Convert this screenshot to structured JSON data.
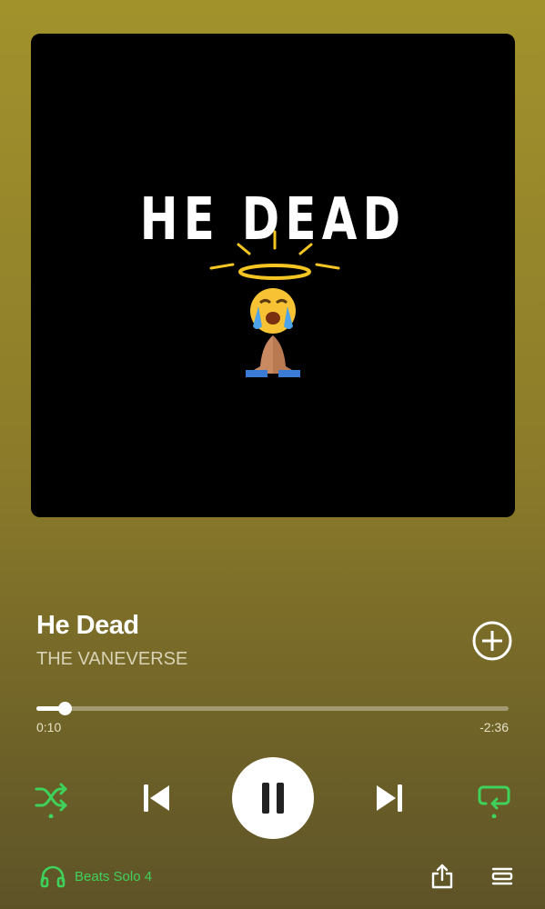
{
  "colors": {
    "accent_green": "#3fd25b",
    "background_top": "#a2922c",
    "background_bottom": "#5d5327"
  },
  "album_art": {
    "text": "HE DEAD",
    "emoji_icon": "crying-praying-halo-icon"
  },
  "track": {
    "title": "He Dead",
    "artist": "THE VANEVERSE"
  },
  "progress": {
    "elapsed": "0:10",
    "remaining": "-2:36",
    "fraction": 0.06
  },
  "controls": {
    "shuffle_icon": "shuffle-icon",
    "prev_icon": "skip-back-icon",
    "play_pause_icon": "pause-icon",
    "next_icon": "skip-forward-icon",
    "repeat_icon": "repeat-icon"
  },
  "footer": {
    "device_name": "Beats Solo 4",
    "device_icon": "headphones-icon"
  }
}
